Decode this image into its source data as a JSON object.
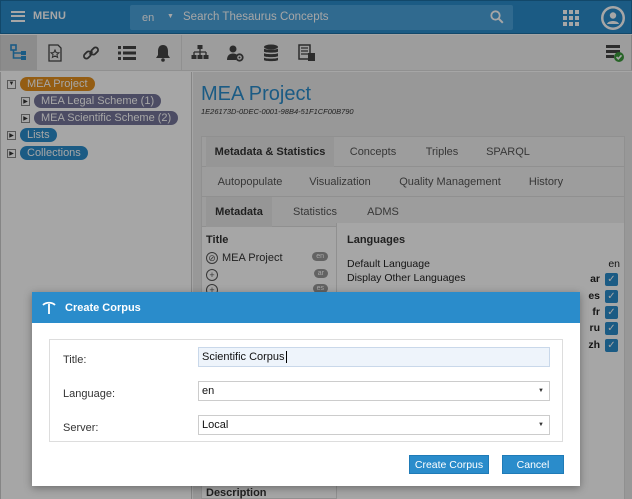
{
  "topbar": {
    "menu_label": "MENU",
    "language": "en",
    "search_placeholder": "Search Thesaurus Concepts"
  },
  "tree": {
    "project": "MEA Project",
    "schemes": [
      "MEA Legal Scheme (1)",
      "MEA Scientific Scheme (2)"
    ],
    "lists": "Lists",
    "collections": "Collections"
  },
  "project": {
    "title": "MEA Project",
    "uri": "1E26173D-0DEC-0001-98B4-51F1CF00B790"
  },
  "tabs": {
    "row1": [
      "Metadata & Statistics",
      "Concepts",
      "Triples",
      "SPARQL"
    ],
    "row2": [
      "Autopopulate",
      "Visualization",
      "Quality Management",
      "History"
    ],
    "row3": [
      "Metadata",
      "Statistics",
      "ADMS"
    ]
  },
  "metadata": {
    "title_header": "Title",
    "title_rows": [
      {
        "text": "MEA Project",
        "lang": "en"
      },
      {
        "text": "",
        "lang": "ar"
      },
      {
        "text": "",
        "lang": "es"
      }
    ],
    "languages_header": "Languages",
    "default_language_label": "Default Language",
    "default_language_value": "en",
    "display_other_label": "Display Other Languages",
    "other_languages": [
      "ar",
      "es",
      "fr",
      "ru",
      "zh"
    ],
    "description_label": "Description"
  },
  "dialog": {
    "title": "Create Corpus",
    "title_label": "Title:",
    "title_value": "Scientific Corpus",
    "language_label": "Language:",
    "language_value": "en",
    "server_label": "Server:",
    "server_value": "Local",
    "create_label": "Create Corpus",
    "cancel_label": "Cancel"
  },
  "colors": {
    "primary": "#2a8ccb",
    "project_pill": "#e3901e",
    "scheme_pill": "#76769a"
  }
}
